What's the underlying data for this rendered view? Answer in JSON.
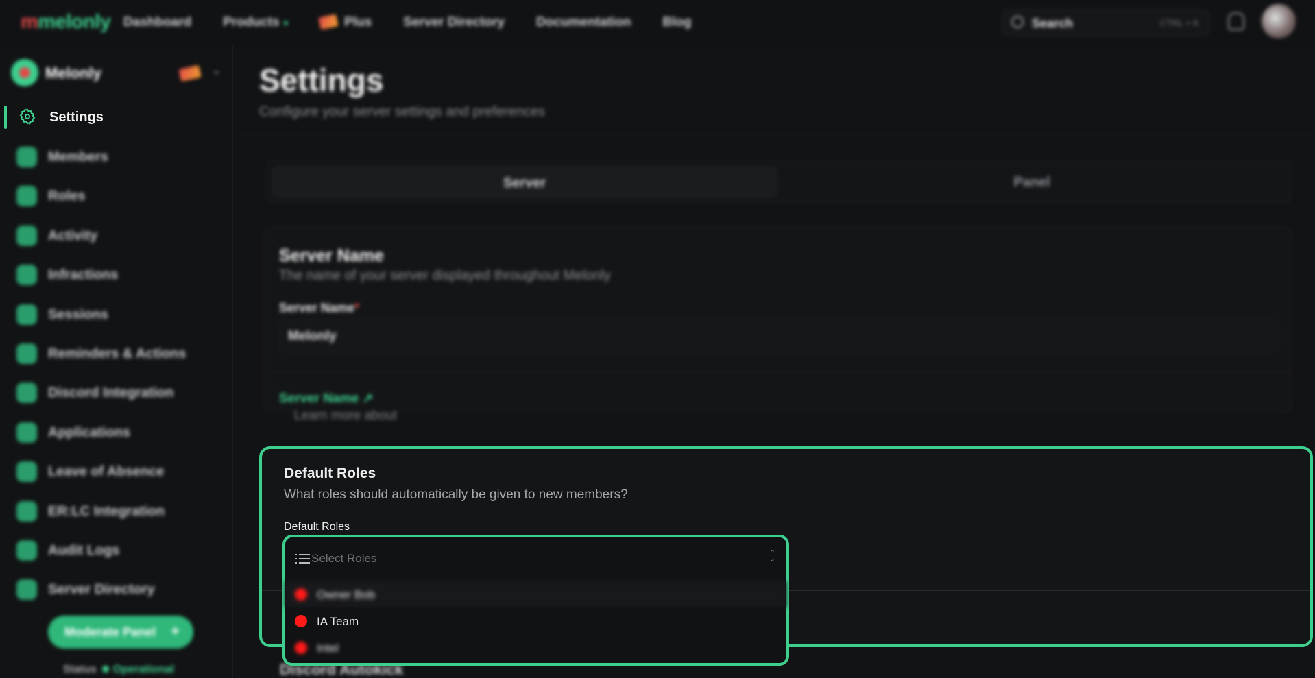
{
  "topnav": {
    "logo": "melonly",
    "links": [
      "Dashboard",
      "Products",
      "Plus",
      "Server Directory",
      "Documentation",
      "Blog"
    ],
    "search_label": "Search",
    "search_shortcut": "CTRL + K"
  },
  "sidebar": {
    "server_name": "Melonly",
    "active_item": "Settings",
    "items": [
      "Members",
      "Roles",
      "Activity",
      "Infractions",
      "Sessions",
      "Reminders & Actions",
      "Discord Integration",
      "Applications",
      "Leave of Absence",
      "ER:LC Integration",
      "Audit Logs",
      "Server Directory"
    ],
    "moderate_button": "Moderate Panel",
    "status_label": "Status",
    "status_value": "Operational"
  },
  "page": {
    "title": "Settings",
    "subtitle": "Configure your server settings and preferences"
  },
  "tabs": [
    "Server",
    "Panel"
  ],
  "server_name_card": {
    "title": "Server Name",
    "description": "The name of your server displayed throughout Melonly",
    "field_label": "Server Name",
    "field_value": "Melonly",
    "footer_prefix": "Learn more about",
    "footer_link": "Server Name"
  },
  "default_roles_card": {
    "title": "Default Roles",
    "description": "What roles should automatically be given to new members?",
    "field_label": "Default Roles",
    "placeholder": "Select Roles",
    "options": [
      {
        "label": "Owner Bob",
        "color": "#ff1a1a"
      },
      {
        "label": "IA Team",
        "color": "#ff1a1a"
      },
      {
        "label": "Intel",
        "color": "#ff1a1a"
      }
    ]
  },
  "next_card_title": "Discord Autokick",
  "colors": {
    "accent": "#3ecf8e",
    "background": "#121315",
    "role": "#ff1a1a"
  }
}
